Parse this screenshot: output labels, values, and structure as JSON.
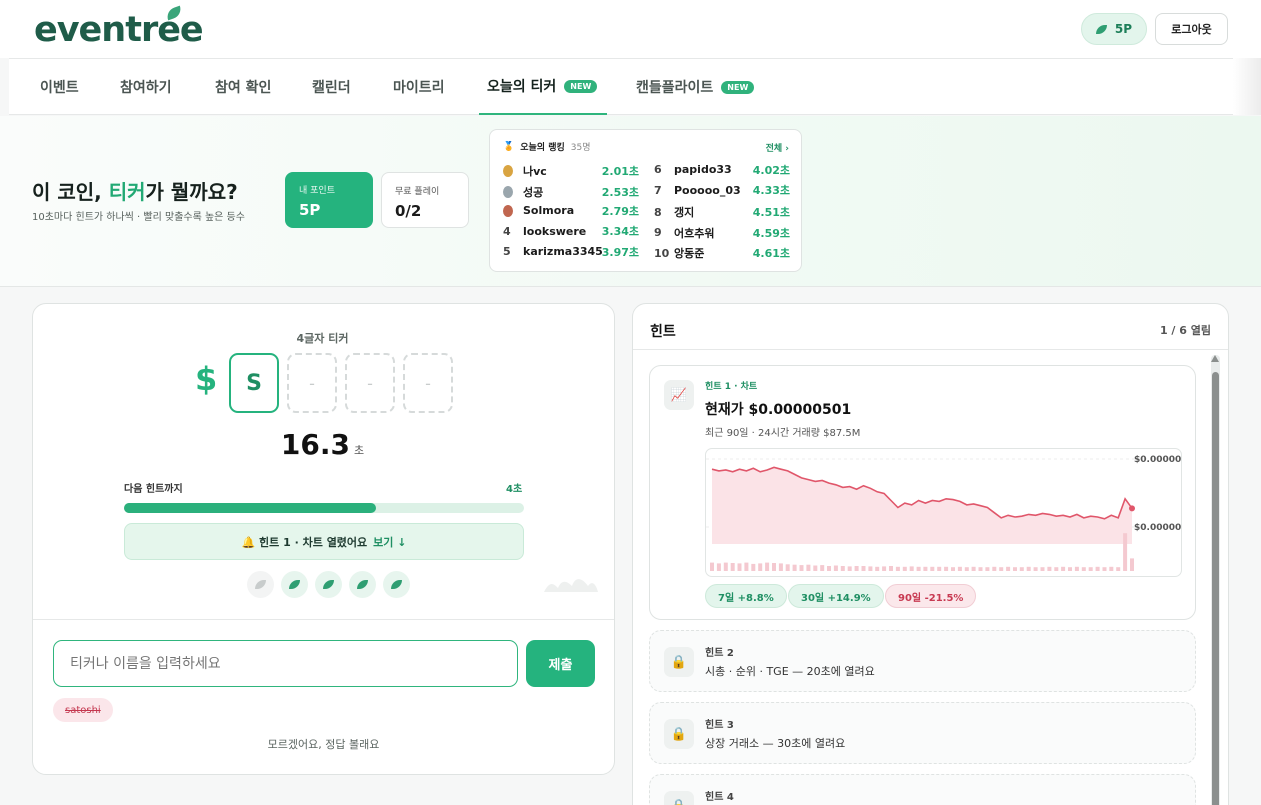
{
  "header": {
    "logo": "eventree",
    "points": "5P",
    "logout": "로그아웃"
  },
  "nav": {
    "tabs": [
      {
        "label": "이벤트",
        "active": false,
        "badge": ""
      },
      {
        "label": "참여하기",
        "active": false,
        "badge": ""
      },
      {
        "label": "참여 확인",
        "active": false,
        "badge": ""
      },
      {
        "label": "캘린더",
        "active": false,
        "badge": ""
      },
      {
        "label": "마이트리",
        "active": false,
        "badge": ""
      },
      {
        "label": "오늘의 티커",
        "active": true,
        "badge": "NEW"
      },
      {
        "label": "캔들플라이트",
        "active": false,
        "badge": "NEW"
      }
    ]
  },
  "hero": {
    "title_pre": "이 코인, ",
    "title_accent": "티커",
    "title_post": "가 뭘까요?",
    "subtitle": "10초마다 힌트가 하나씩 · 빨리 맞출수록 높은 등수",
    "my_points_label": "내 포인트",
    "my_points_value": "5P",
    "free_play_label": "무료 플레이",
    "free_play_value": "0/2"
  },
  "ranking": {
    "title": "오늘의 랭킹",
    "count": "35명",
    "view_all": "전체 ›",
    "left": [
      {
        "rank": "1",
        "medal": "gold",
        "name": "나vc",
        "time": "2.01초"
      },
      {
        "rank": "2",
        "medal": "silver",
        "name": "성공",
        "time": "2.53초"
      },
      {
        "rank": "3",
        "medal": "bronze",
        "name": "Solmora",
        "time": "2.79초"
      },
      {
        "rank": "4",
        "medal": "",
        "name": "lookswere",
        "time": "3.34초"
      },
      {
        "rank": "5",
        "medal": "",
        "name": "karizma3345",
        "time": "3.97초"
      }
    ],
    "right": [
      {
        "rank": "6",
        "name": "papido33",
        "time": "4.02초"
      },
      {
        "rank": "7",
        "name": "Pooooo_03",
        "time": "4.33초"
      },
      {
        "rank": "8",
        "name": "갱지",
        "time": "4.51초"
      },
      {
        "rank": "9",
        "name": "어흐추워",
        "time": "4.59초"
      },
      {
        "rank": "10",
        "name": "앙동준",
        "time": "4.61초"
      }
    ]
  },
  "game": {
    "letters_label": "4글자 티커",
    "dollar": "$",
    "slots": [
      "S",
      "-",
      "-",
      "-"
    ],
    "timer": "16.3",
    "timer_unit": "초",
    "next_hint_label": "다음 힌트까지",
    "next_hint_value": "4초",
    "progress": 0.63,
    "hint_opened": "🔔 힌트 1 · 차트 열렸어요",
    "hint_view": "보기 ↓",
    "input_placeholder": "티커나 이름을 입력하세요",
    "submit": "제출",
    "wrong_guess": "satoshi",
    "give_up": "모르겠어요, 정답 볼래요"
  },
  "hints": {
    "title": "힌트",
    "open_count": "1 / 6 열림",
    "hint1": {
      "tag": "힌트 1 · 차트",
      "price": "현재가 $0.00000501",
      "volume": "최근 90일 · 24시간 거래량 $87.5M",
      "axis_top": "$0.00000",
      "axis_bottom": "$0.00000",
      "changes": [
        {
          "label": "7일 +8.8%",
          "dir": "up"
        },
        {
          "label": "30일 +14.9%",
          "dir": "up"
        },
        {
          "label": "90일 -21.5%",
          "dir": "down"
        }
      ]
    },
    "locked": [
      {
        "title": "힌트 2",
        "desc": "시총 · 순위 · TGE — 20초에 열려요"
      },
      {
        "title": "힌트 3",
        "desc": "상장 거래소 — 30초에 열려요"
      },
      {
        "title": "힌트 4",
        "desc": ""
      }
    ]
  },
  "chart_data": {
    "type": "area",
    "title": "",
    "series": [
      {
        "values": [
          0.86,
          0.84,
          0.85,
          0.83,
          0.86,
          0.84,
          0.87,
          0.83,
          0.85,
          0.88,
          0.86,
          0.84,
          0.8,
          0.76,
          0.74,
          0.72,
          0.73,
          0.7,
          0.68,
          0.65,
          0.66,
          0.63,
          0.67,
          0.64,
          0.6,
          0.58,
          0.5,
          0.42,
          0.47,
          0.45,
          0.5,
          0.47,
          0.5,
          0.49,
          0.52,
          0.51,
          0.49,
          0.45,
          0.46,
          0.44,
          0.42,
          0.36,
          0.3,
          0.33,
          0.31,
          0.32,
          0.34,
          0.33,
          0.35,
          0.34,
          0.32,
          0.33,
          0.31,
          0.34,
          0.3,
          0.32,
          0.31,
          0.29,
          0.33,
          0.3,
          0.52,
          0.41
        ]
      }
    ],
    "volume": [
      0.2,
      0.18,
      0.2,
      0.19,
      0.18,
      0.2,
      0.17,
      0.18,
      0.2,
      0.19,
      0.18,
      0.16,
      0.15,
      0.14,
      0.15,
      0.13,
      0.14,
      0.12,
      0.13,
      0.12,
      0.11,
      0.12,
      0.12,
      0.11,
      0.1,
      0.11,
      0.12,
      0.1,
      0.1,
      0.11,
      0.1,
      0.1,
      0.1,
      0.1,
      0.1,
      0.09,
      0.1,
      0.09,
      0.1,
      0.09,
      0.09,
      0.1,
      0.09,
      0.1,
      0.09,
      0.09,
      0.1,
      0.09,
      0.09,
      0.1,
      0.09,
      0.1,
      0.09,
      0.1,
      0.09,
      0.09,
      0.1,
      0.09,
      0.1,
      0.09,
      0.9,
      0.3
    ],
    "grid": true,
    "colors": {
      "line": "#e0566a",
      "fill": "#fbe3e7"
    }
  },
  "colors": {
    "accent": "#25b37e",
    "accent_dark": "#1f8f63",
    "danger": "#c83a52"
  }
}
